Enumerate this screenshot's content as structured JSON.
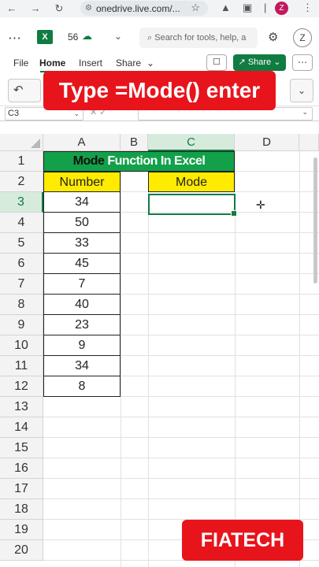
{
  "browser": {
    "url": "onedrive.live.com/...",
    "profile_initial": "Z"
  },
  "app": {
    "title": "56",
    "search_placeholder": "Search for tools, help, a",
    "avatar_initial": "Z"
  },
  "ribbon": {
    "tabs": [
      "File",
      "Home",
      "Insert",
      "Share"
    ],
    "active_tab": "Home",
    "share_label": "Share"
  },
  "overlay": {
    "instruction": "Type =Mode() enter",
    "brand": "FIATECH"
  },
  "formula_bar": {
    "name_box": "C3",
    "formula": ""
  },
  "grid": {
    "columns": [
      "A",
      "B",
      "C",
      "D"
    ],
    "selected_column": "C",
    "rows": [
      "1",
      "2",
      "3",
      "4",
      "5",
      "6",
      "7",
      "8",
      "9",
      "10",
      "11",
      "12",
      "13",
      "14",
      "15",
      "16",
      "17",
      "18",
      "19",
      "20"
    ],
    "selected_row": "3",
    "title_part1": "Mode",
    "title_part2": "Function In Excel",
    "header_number": "Number",
    "header_mode": "Mode",
    "numbers": [
      "34",
      "50",
      "33",
      "45",
      "7",
      "40",
      "23",
      "9",
      "34",
      "8"
    ],
    "active_cell": "C3",
    "colors": {
      "title_fill": "#12a14a",
      "header_fill": "#ffeb00",
      "selection": "#107c41"
    }
  }
}
